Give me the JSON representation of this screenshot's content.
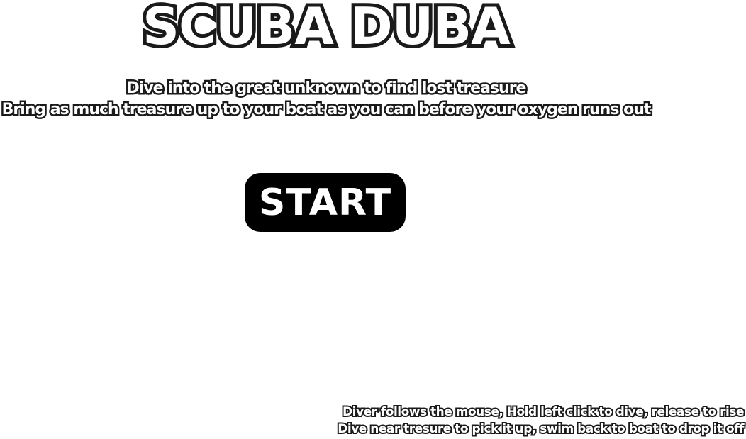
{
  "title": "SCUBA DUBA",
  "subtitle": {
    "line1": "Dive into the great unknown to find lost treasure",
    "line2": "Bring as much treasure up to your boat as you can before your oxygen runs out"
  },
  "start_button": {
    "label": "START"
  },
  "instructions": {
    "line1": "Diver follows the mouse, Hold left click to dive, release to rise",
    "line2": "Dive near tresure to pick it up, swim back to boat to drop it off"
  },
  "colors": {
    "background": "#ffffff",
    "text_fill": "#ffffff",
    "text_outline": "#1a1a1a",
    "button_bg": "#000000"
  }
}
